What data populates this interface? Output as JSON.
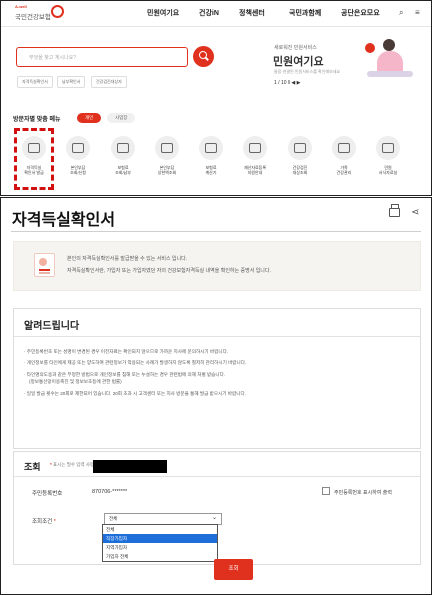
{
  "top": {
    "logo": {
      "tagline": "A-well",
      "name": "국민건강보험"
    },
    "nav": [
      "민원여기요",
      "건강iN",
      "정책센터",
      "국민과함께",
      "공단은요모요"
    ],
    "search": {
      "placeholder": "무엇을 찾고 계시나요?",
      "tags": [
        "자격득실확인서",
        "납부확인서",
        "건강검진대상자"
      ]
    },
    "banner": {
      "subtitle": "새로워진 민원서비스",
      "title": "민원여기요",
      "desc": "통합·연결된 민원서비스를 확인해보세요",
      "pager": "1 / 10  ‖  ◀  ▶"
    },
    "custom_menu": {
      "title": "방문자별 맞춤 메뉴",
      "tabs": [
        "개인",
        "사업장"
      ],
      "services": [
        "자격득실\n확인서 발급",
        "본인부담\n조회/신청",
        "보험료\n조회/납부",
        "본인부담\n상한액조회",
        "보험료\n계산기",
        "재산자료등록\n지원안내",
        "건강검진\n대상조회",
        "가족\n건강관리",
        "민원\n서식자료실"
      ]
    }
  },
  "page": {
    "title": "자격득실확인서",
    "intro": [
      "본인의 자격득실확인서를 발급받을 수 있는 서비스 입니다.",
      "자격득실확인서란, 가입자 또는 가입자였던 자의 건강보험자격득실 내역을 확인하는 증명서 입니다."
    ],
    "notice": {
      "title": "알려드립니다",
      "items": [
        "· 주민등록번호 또는 성명이 변경된 경우 이전자료는 확인되지 않으므로 가까운 지사에 문의하시기 바랍니다.",
        "· 개인정보를 타인에게 제공 또는 양도하여 관련정보가 악용되는 사례가 발생하지 않도록 철저히 관리하시기 바랍니다.",
        "· 타인명의도용과 같은 부정한 방법으로 개인정보를 침해 또는 누설하는 경우 관련법에 의해 처벌 받습니다.",
        "(정보통신망이용촉진 및 정보보호등에 관한 법률)",
        "· 일일 발급 횟수는 20회로 제한되어 있습니다. 20회 초과 시 고객센터 또는 지사 방문을 통해 발급 받으시기 바랍니다."
      ]
    },
    "query": {
      "title": "조회",
      "required_note": "표시는 필수 입력 사항입니다.",
      "resident_label": "주민등록번호",
      "resident_value": "870706-*******",
      "show_resident_label": "주민등록번호 표시하여 출력",
      "condition_label": "조회조건",
      "select_value": "전체",
      "options": [
        "전체",
        "직장가입자",
        "지역가입자",
        "가입자 전체"
      ],
      "selected_option": "직장가입자",
      "button": "조회"
    }
  }
}
